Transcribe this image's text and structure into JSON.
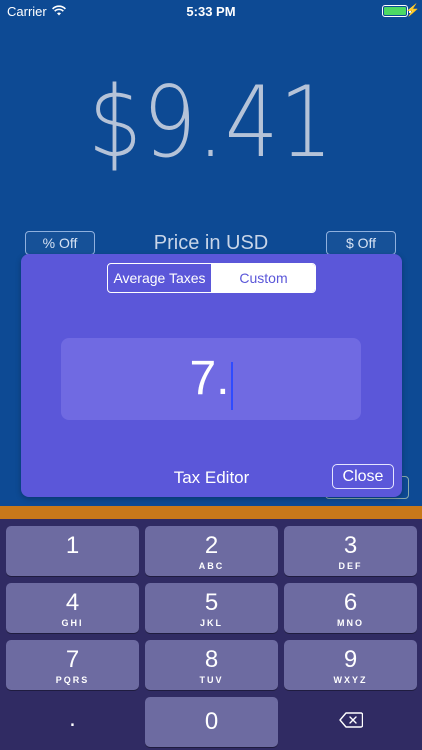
{
  "status": {
    "carrier": "Carrier",
    "time": "5:33 PM"
  },
  "price": {
    "amount": "$9.41",
    "label": "Price in USD",
    "pct_off": "% Off",
    "dollar_off": "$ Off"
  },
  "tax_editor": {
    "segments": [
      "Average Taxes",
      "Custom"
    ],
    "selected_segment": "Custom",
    "value": "7.",
    "title": "Tax Editor",
    "close": "Close"
  },
  "keypad": {
    "keys": [
      {
        "num": "1",
        "letters": ""
      },
      {
        "num": "2",
        "letters": "ABC"
      },
      {
        "num": "3",
        "letters": "DEF"
      },
      {
        "num": "4",
        "letters": "GHI"
      },
      {
        "num": "5",
        "letters": "JKL"
      },
      {
        "num": "6",
        "letters": "MNO"
      },
      {
        "num": "7",
        "letters": "PQRS"
      },
      {
        "num": "8",
        "letters": "TUV"
      },
      {
        "num": "9",
        "letters": "WXYZ"
      }
    ],
    "dot": ".",
    "zero": "0",
    "backspace_icon": "backspace-icon"
  },
  "colors": {
    "background": "#0d4a94",
    "panel": "#5b57d9",
    "accent_strip": "#c8781a",
    "keypad_bg": "#302b63",
    "key": "#6d6ba1"
  }
}
